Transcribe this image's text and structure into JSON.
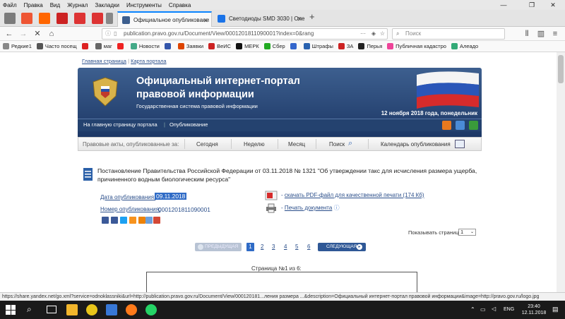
{
  "menu": [
    "Файл",
    "Правка",
    "Вид",
    "Журнал",
    "Закладки",
    "Инструменты",
    "Справка"
  ],
  "tabs": [
    {
      "label": "Официальное опубликовани",
      "favicon_color": "#3d5f8f"
    },
    {
      "label": "Светодиоды SMD 3030 | Onelec",
      "favicon_color": "#1a73e8"
    }
  ],
  "nav": {
    "url": "publication.pravo.gov.ru/Document/View/0001201811090001?index=0&rang",
    "search_placeholder": "Поиск"
  },
  "bookmarks": [
    {
      "label": "Редкие1",
      "color": "#888"
    },
    {
      "label": "Часто посещ",
      "color": "#555"
    },
    {
      "label": "",
      "color": "#d22"
    },
    {
      "label": "маг",
      "color": "#666"
    },
    {
      "label": "",
      "color": "#e22"
    },
    {
      "label": "Новости",
      "color": "#4a8"
    },
    {
      "label": "",
      "color": "#35a"
    },
    {
      "label": "Заявки",
      "color": "#d40"
    },
    {
      "label": "ВеИС",
      "color": "#c22"
    },
    {
      "label": "МЕРК",
      "color": "#111"
    },
    {
      "label": "Сбер",
      "color": "#2a2"
    },
    {
      "label": "",
      "color": "#36c"
    },
    {
      "label": "Штрафы",
      "color": "#2962b0"
    },
    {
      "label": "ЗА",
      "color": "#c22"
    },
    {
      "label": "Перья",
      "color": "#222"
    },
    {
      "label": "Публичная кадастро",
      "color": "#e49"
    },
    {
      "label": "Алеадо",
      "color": "#3a7"
    }
  ],
  "page": {
    "crumb_home": "Главная страница",
    "crumb_sep": "|",
    "crumb_map": "Карта портала",
    "portal_title": "Официальный интернет-портал правовой информации",
    "portal_subtitle": "Государственная система правовой информации",
    "portal_date": "12 ноября 2018 года, понедельник",
    "nav_home": "На главную страницу портала",
    "nav_sep": "|",
    "nav_pub": "Опубликование",
    "filter_label": "Правовые акты, опубликованные за:",
    "filter_today": "Сегодня",
    "filter_week": "Неделю",
    "filter_month": "Месяц",
    "filter_search": "Поиск",
    "filter_calendar": "Календарь опубликования",
    "doc_title": "Постановление Правительства Российской Федерации от 03.11.2018 № 1321 \"Об утверждении такс для исчисления размера ущерба, причиненного водным биологическим ресурса\"",
    "pubdate_label": "Дата опубликования:",
    "pubdate_value": "09.11.2018",
    "pubnum_label": "Номер опубликования:",
    "pubnum_value": "0001201811090001",
    "pdf_prefix": "- ",
    "pdf_link": "скачать PDF-файл для качественной печати (174 Кб)",
    "print_prefix": "- ",
    "print_link": "Печать документа",
    "pages_label": "Показывать страниц:",
    "pages_value": "1",
    "prev_label": "ПРЕДЫДУЩАЯ",
    "next_label": "СЛЕДУЮЩАЯ",
    "page_numbers": [
      "1",
      "2",
      "3",
      "4",
      "5",
      "6"
    ],
    "page_count": "Страница №1 из 6:",
    "share_colors": [
      "#3b5998",
      "#3b5998",
      "#1da1f2",
      "#f7931e",
      "#ed8207",
      "#6ca0dc",
      "#d34836"
    ]
  },
  "status": "https://share.yandex.net/go.xml?service=odnoklassniki&url=http://publication.pravo.gov.ru/Document/View/000120181...ления размера ...&description=Официальный интернет-портал правовой информации&image=http://pravo.gov.ru/logo.jpg",
  "tray": {
    "lang": "ENG",
    "time": "23:40",
    "date": "12.11.2018"
  }
}
